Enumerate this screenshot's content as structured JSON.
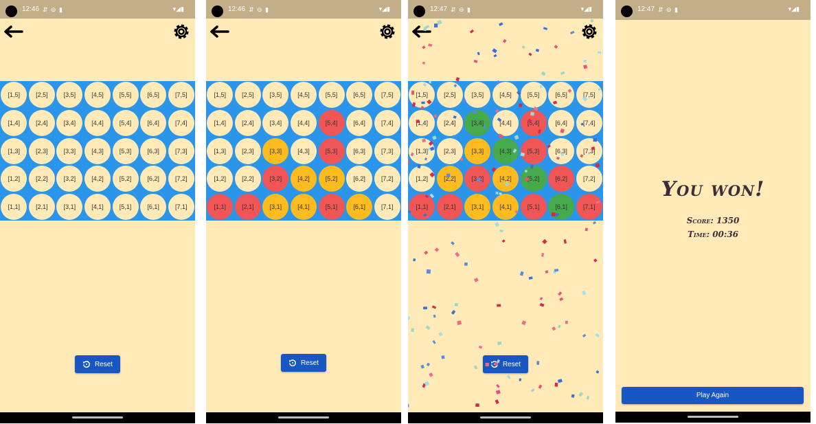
{
  "screens": [
    {
      "time": "12:46",
      "reset_label": "Reset",
      "cells": [
        [
          {
            "label": "[1,5]",
            "state": "empty"
          },
          {
            "label": "[2,5]",
            "state": "empty"
          },
          {
            "label": "[3,5]",
            "state": "empty"
          },
          {
            "label": "[4,5]",
            "state": "empty"
          },
          {
            "label": "[5,5]",
            "state": "empty"
          },
          {
            "label": "[6,5]",
            "state": "empty"
          },
          {
            "label": "[7,5]",
            "state": "empty"
          }
        ],
        [
          {
            "label": "[1,4]",
            "state": "empty"
          },
          {
            "label": "[2,4]",
            "state": "empty"
          },
          {
            "label": "[3,4]",
            "state": "empty"
          },
          {
            "label": "[4,4]",
            "state": "empty"
          },
          {
            "label": "[5,4]",
            "state": "empty"
          },
          {
            "label": "[6,4]",
            "state": "empty"
          },
          {
            "label": "[7,4]",
            "state": "empty"
          }
        ],
        [
          {
            "label": "[1,3]",
            "state": "empty"
          },
          {
            "label": "[2,3]",
            "state": "empty"
          },
          {
            "label": "[3,3]",
            "state": "empty"
          },
          {
            "label": "[4,3]",
            "state": "empty"
          },
          {
            "label": "[5,3]",
            "state": "empty"
          },
          {
            "label": "[6,3]",
            "state": "empty"
          },
          {
            "label": "[7,3]",
            "state": "empty"
          }
        ],
        [
          {
            "label": "[1,2]",
            "state": "empty"
          },
          {
            "label": "[2,2]",
            "state": "empty"
          },
          {
            "label": "[3,2]",
            "state": "empty"
          },
          {
            "label": "[4,2]",
            "state": "empty"
          },
          {
            "label": "[5,2]",
            "state": "empty"
          },
          {
            "label": "[6,2]",
            "state": "empty"
          },
          {
            "label": "[7,2]",
            "state": "empty"
          }
        ],
        [
          {
            "label": "[1,1]",
            "state": "empty"
          },
          {
            "label": "[2,1]",
            "state": "empty"
          },
          {
            "label": "[3,1]",
            "state": "empty"
          },
          {
            "label": "[4,1]",
            "state": "empty"
          },
          {
            "label": "[5,1]",
            "state": "empty"
          },
          {
            "label": "[6,1]",
            "state": "empty"
          },
          {
            "label": "[7,1]",
            "state": "empty"
          }
        ]
      ]
    },
    {
      "time": "12:46",
      "reset_label": "Reset",
      "cells": [
        [
          {
            "label": "[1,5]",
            "state": "empty"
          },
          {
            "label": "[2,5]",
            "state": "empty"
          },
          {
            "label": "[3,5]",
            "state": "empty"
          },
          {
            "label": "[4,5]",
            "state": "empty"
          },
          {
            "label": "[5,5]",
            "state": "empty"
          },
          {
            "label": "[6,5]",
            "state": "empty"
          },
          {
            "label": "[7,5]",
            "state": "empty"
          }
        ],
        [
          {
            "label": "[1,4]",
            "state": "empty"
          },
          {
            "label": "[2,4]",
            "state": "empty"
          },
          {
            "label": "[3,4]",
            "state": "empty"
          },
          {
            "label": "[4,4]",
            "state": "empty"
          },
          {
            "label": "[5,4]",
            "state": "red"
          },
          {
            "label": "[6,4]",
            "state": "empty"
          },
          {
            "label": "[7,4]",
            "state": "empty"
          }
        ],
        [
          {
            "label": "[1,3]",
            "state": "empty"
          },
          {
            "label": "[2,3]",
            "state": "empty"
          },
          {
            "label": "[3,3]",
            "state": "yellow"
          },
          {
            "label": "[4,3]",
            "state": "empty"
          },
          {
            "label": "[5,3]",
            "state": "red"
          },
          {
            "label": "[6,3]",
            "state": "empty"
          },
          {
            "label": "[7,3]",
            "state": "empty"
          }
        ],
        [
          {
            "label": "[1,2]",
            "state": "empty"
          },
          {
            "label": "[2,2]",
            "state": "empty"
          },
          {
            "label": "[3,2]",
            "state": "red"
          },
          {
            "label": "[4,2]",
            "state": "yellow"
          },
          {
            "label": "[5,2]",
            "state": "yellow"
          },
          {
            "label": "[6,2]",
            "state": "empty"
          },
          {
            "label": "[7,2]",
            "state": "empty"
          }
        ],
        [
          {
            "label": "[1,1]",
            "state": "red"
          },
          {
            "label": "[2,1]",
            "state": "red"
          },
          {
            "label": "[3,1]",
            "state": "yellow"
          },
          {
            "label": "[4,1]",
            "state": "yellow"
          },
          {
            "label": "[5,1]",
            "state": "red"
          },
          {
            "label": "[6,1]",
            "state": "yellow"
          },
          {
            "label": "[7,1]",
            "state": "empty"
          }
        ]
      ]
    },
    {
      "time": "12:47",
      "reset_label": "Reset",
      "cells": [
        [
          {
            "label": "[1,5]",
            "state": "empty"
          },
          {
            "label": "[2,5]",
            "state": "empty"
          },
          {
            "label": "[3,5]",
            "state": "empty"
          },
          {
            "label": "[4,5]",
            "state": "empty"
          },
          {
            "label": "[5,5]",
            "state": "empty"
          },
          {
            "label": "[6,5]",
            "state": "empty"
          },
          {
            "label": "[7,5]",
            "state": "empty"
          }
        ],
        [
          {
            "label": "[1,4]",
            "state": "empty"
          },
          {
            "label": "[2,4]",
            "state": "empty"
          },
          {
            "label": "[3,4]",
            "state": "green"
          },
          {
            "label": "[4,4]",
            "state": "empty"
          },
          {
            "label": "[5,4]",
            "state": "red"
          },
          {
            "label": "[6,4]",
            "state": "empty"
          },
          {
            "label": "[7,4]",
            "state": "empty"
          }
        ],
        [
          {
            "label": "[1,3]",
            "state": "empty"
          },
          {
            "label": "[2,3]",
            "state": "empty"
          },
          {
            "label": "[3,3]",
            "state": "yellow"
          },
          {
            "label": "[4,3]",
            "state": "green"
          },
          {
            "label": "[5,3]",
            "state": "red"
          },
          {
            "label": "[6,3]",
            "state": "empty"
          },
          {
            "label": "[7,3]",
            "state": "empty"
          }
        ],
        [
          {
            "label": "[1,2]",
            "state": "empty"
          },
          {
            "label": "[2,2]",
            "state": "yellow"
          },
          {
            "label": "[3,2]",
            "state": "red"
          },
          {
            "label": "[4,2]",
            "state": "yellow"
          },
          {
            "label": "[5,2]",
            "state": "green"
          },
          {
            "label": "[6,2]",
            "state": "red"
          },
          {
            "label": "[7,2]",
            "state": "empty"
          }
        ],
        [
          {
            "label": "[1,1]",
            "state": "red"
          },
          {
            "label": "[2,1]",
            "state": "red"
          },
          {
            "label": "[3,1]",
            "state": "yellow"
          },
          {
            "label": "[4,1]",
            "state": "yellow"
          },
          {
            "label": "[5,1]",
            "state": "red"
          },
          {
            "label": "[6,1]",
            "state": "green"
          },
          {
            "label": "[7,1]",
            "state": "red"
          }
        ]
      ]
    }
  ],
  "won_screen": {
    "time": "12:47",
    "title": "You won!",
    "score": "Score: 1350",
    "time_line": "Time: 00:36",
    "play_again_label": "Play Again"
  },
  "icons": {
    "back": "back-arrow-icon",
    "settings": "gear-icon",
    "reset": "reset-icon"
  },
  "colors": {
    "background": "#ffeab8",
    "statusbar": "#c2ae88",
    "grid": "#2a95e9",
    "red": "#f05656",
    "yellow": "#fcbb1e",
    "green": "#46a94c",
    "button": "#1856c4"
  }
}
